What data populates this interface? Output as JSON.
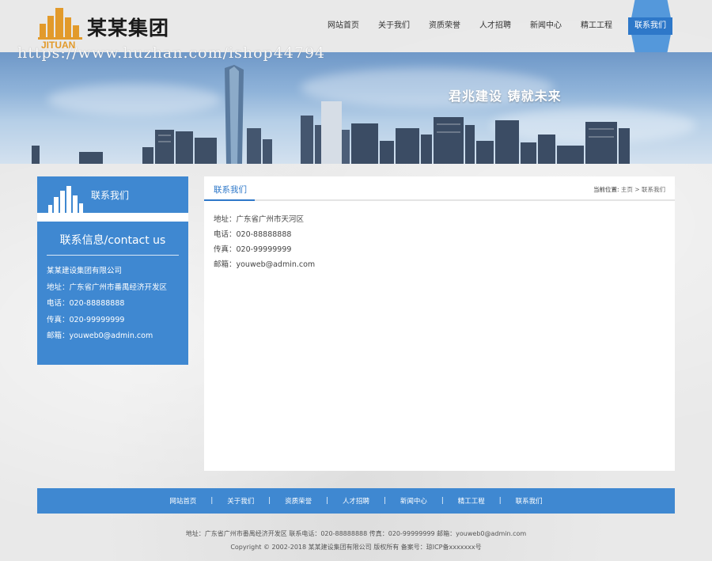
{
  "brand": {
    "logo_sub": "JITUAN",
    "name": "某某集团",
    "brand_color": "#e29a2b"
  },
  "watermark": "https://www.huzhan.com/ishop44794",
  "nav": {
    "items": [
      "网站首页",
      "关于我们",
      "资质荣誉",
      "人才招聘",
      "新闻中心",
      "精工工程",
      "联系我们"
    ],
    "active": "联系我们",
    "accent_color": "#2e78c9"
  },
  "banner": {
    "slogan": "君兆建设 铸就未来"
  },
  "sidebar": {
    "title": "联系我们",
    "subtitle": "联系信息/contact us",
    "lines": [
      "某某建设集团有限公司",
      "地址：广东省广州市番禺经济开发区",
      "电话：020-88888888",
      "传真：020-99999999",
      "邮箱：youweb0@admin.com"
    ],
    "bg_color": "#3f88d1"
  },
  "content": {
    "title": "联系我们",
    "breadcrumb_label": "当前位置:",
    "breadcrumb_home": "主页",
    "breadcrumb_sep": ">",
    "breadcrumb_current": "联系我们",
    "lines": [
      "地址：广东省广州市天河区",
      "电话：020-88888888",
      "传真：020-99999999",
      "邮箱：youweb@admin.com"
    ]
  },
  "footer": {
    "nav": [
      "网站首页",
      "关于我们",
      "资质荣誉",
      "人才招聘",
      "新闻中心",
      "精工工程",
      "联系我们"
    ],
    "separator": "|",
    "info_line": "地址：广东省广州市番禺经济开发区  联系电话：020-88888888  传真：020-99999999  邮箱：youweb0@admin.com",
    "copyright_line": "Copyright © 2002-2018 某某建设集团有限公司 版权所有      备案号：琼ICP备xxxxxxx号"
  }
}
